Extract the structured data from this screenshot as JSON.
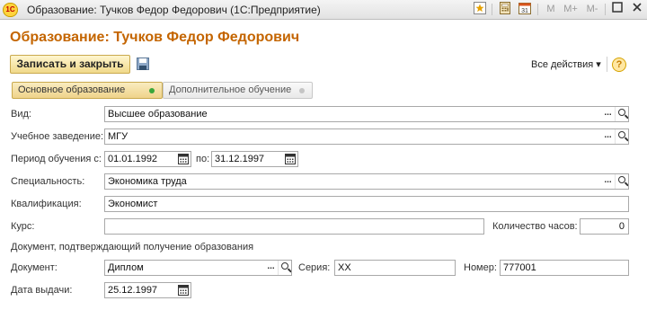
{
  "window": {
    "logo_text": "1С",
    "title": "Образование: Тучков Федор Федорович  (1С:Предприятие)",
    "mem_buttons": [
      "M",
      "M+",
      "M-"
    ]
  },
  "form": {
    "title": "Образование: Тучков Федор Федорович",
    "save_close_label": "Записать и закрыть",
    "all_actions_label": "Все действия ▾",
    "help_label": "?"
  },
  "tabs": [
    {
      "label": "Основное образование",
      "active": true
    },
    {
      "label": "Дополнительное обучение",
      "active": false
    }
  ],
  "fields": {
    "kind": {
      "label": "Вид:",
      "value": "Высшее образование"
    },
    "institution": {
      "label": "Учебное заведение:",
      "value": "МГУ"
    },
    "period": {
      "label": "Период обучения с:",
      "from": "01.01.1992",
      "to_label": "по:",
      "to": "31.12.1997"
    },
    "specialty": {
      "label": "Специальность:",
      "value": "Экономика труда"
    },
    "qualification": {
      "label": "Квалификация:",
      "value": "Экономист"
    },
    "course": {
      "label": "Курс:",
      "value": ""
    },
    "hours": {
      "label": "Количество часов:",
      "value": "0"
    },
    "doc_section": "Документ, подтверждающий получение образования",
    "document": {
      "label": "Документ:",
      "value": "Диплом"
    },
    "series": {
      "label": "Серия:",
      "value": "ХХ"
    },
    "number": {
      "label": "Номер:",
      "value": "777001"
    },
    "issue_date": {
      "label": "Дата выдачи:",
      "value": "25.12.1997"
    }
  },
  "icons": {
    "more": "...",
    "search": "magnifier-icon",
    "calendar": "calendar-icon"
  }
}
